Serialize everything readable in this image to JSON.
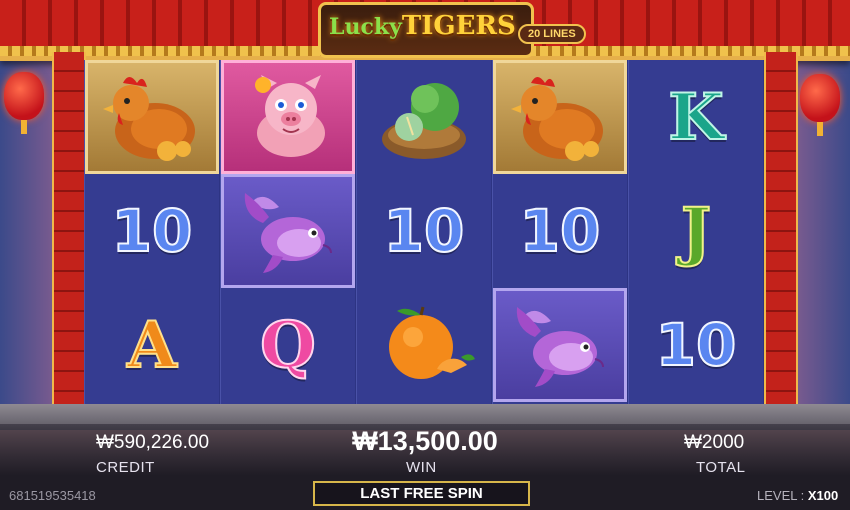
{
  "title": {
    "brand_word1": "Lucky",
    "brand_word2": "TIGERS",
    "lines_badge": "20 LINES"
  },
  "reels": [
    [
      {
        "symbol": "rooster-icon",
        "frame": "gold"
      },
      {
        "symbol": "10"
      },
      {
        "symbol": "A"
      }
    ],
    [
      {
        "symbol": "pig-icon",
        "frame": "pink"
      },
      {
        "symbol": "koi-fish-icon",
        "frame": "purple"
      },
      {
        "symbol": "Q"
      }
    ],
    [
      {
        "symbol": "cabbage-icon"
      },
      {
        "symbol": "10"
      },
      {
        "symbol": "orange-icon"
      }
    ],
    [
      {
        "symbol": "rooster-icon",
        "frame": "gold"
      },
      {
        "symbol": "10"
      },
      {
        "symbol": "koi-fish-icon",
        "frame": "purple"
      }
    ],
    [
      {
        "symbol": "K"
      },
      {
        "symbol": "J"
      },
      {
        "symbol": "10"
      }
    ]
  ],
  "symbol_text": {
    "ten": "10",
    "a": "A",
    "q": "Q",
    "k": "K",
    "j": "J"
  },
  "hud": {
    "credit_value": "₩590,226.00",
    "credit_label": "CREDIT",
    "win_value": "₩13,500.00",
    "win_label": "WIN",
    "total_value": "₩2000",
    "total_label": "TOTAL",
    "spin_button": "LAST FREE SPIN",
    "game_id": "681519535418",
    "level_label": "LEVEL :",
    "level_value": "X100"
  },
  "colors": {
    "roof": "#c8201a",
    "reel_bg": "#353c91",
    "button_border": "#d7b64a"
  }
}
